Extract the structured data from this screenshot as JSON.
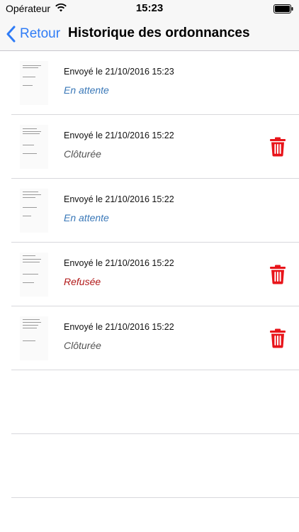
{
  "status_bar": {
    "carrier": "Opérateur",
    "time": "15:23"
  },
  "nav": {
    "back_label": "Retour",
    "title": "Historique des ordonnances"
  },
  "items": [
    {
      "sent": "Envoyé le 21/10/2016 15:23",
      "status": "En attente",
      "status_kind": "wait",
      "deletable": false
    },
    {
      "sent": "Envoyé le 21/10/2016 15:22",
      "status": "Clôturée",
      "status_kind": "closed",
      "deletable": true
    },
    {
      "sent": "Envoyé le 21/10/2016 15:22",
      "status": "En attente",
      "status_kind": "wait",
      "deletable": false
    },
    {
      "sent": "Envoyé le 21/10/2016 15:22",
      "status": "Refusée",
      "status_kind": "refused",
      "deletable": true
    },
    {
      "sent": "Envoyé le 21/10/2016 15:22",
      "status": "Clôturée",
      "status_kind": "closed",
      "deletable": true
    }
  ],
  "colors": {
    "accent": "#2f7cf6",
    "wait": "#3a78b8",
    "closed": "#555555",
    "refused": "#b21a1a",
    "trash": "#e8141a"
  },
  "icons": {
    "delete": "trash-icon",
    "back": "chevron-left-icon"
  }
}
